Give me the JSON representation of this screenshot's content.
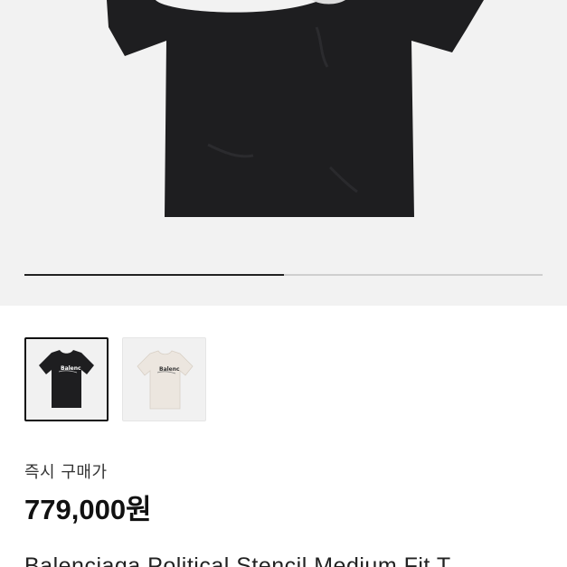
{
  "gallery": {
    "progress_fraction": 0.5,
    "thumbnails": [
      {
        "color_name": "black",
        "selected": true,
        "tshirt_color": "#1e1e20"
      },
      {
        "color_name": "white",
        "selected": false,
        "tshirt_color": "#ece6df"
      }
    ]
  },
  "pricing": {
    "label": "즉시 구매가",
    "price": "779,000원"
  },
  "product": {
    "title": "Balenciaga Political Stencil Medium Fit T..."
  },
  "colors": {
    "hero_background": "#f2f2f2",
    "tshirt_black": "#1e1e20",
    "progress_active": "#222222",
    "progress_track": "#cfcfcf"
  }
}
